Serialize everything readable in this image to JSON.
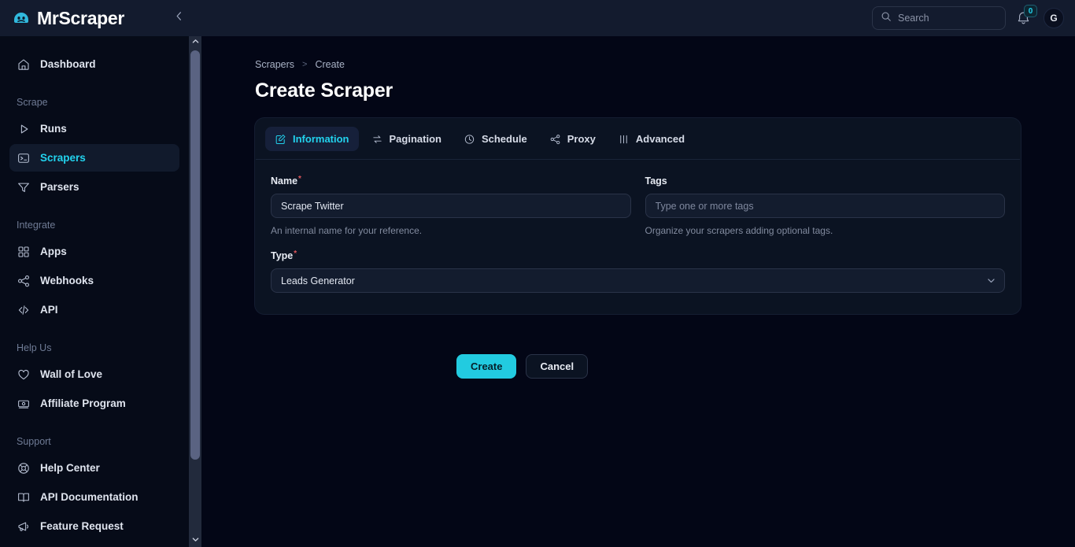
{
  "brand": {
    "name": "MrScraper",
    "logo_icon": "mrscraper-logo-icon",
    "accent": "#22d3ee"
  },
  "topbar": {
    "collapse_icon": "chevron-left-icon",
    "search": {
      "placeholder": "Search",
      "value": "",
      "icon": "search-icon"
    },
    "notifications": {
      "icon": "bell-icon",
      "count": "0"
    },
    "avatar": {
      "initial": "G"
    }
  },
  "sidebar": {
    "groups": [
      {
        "label": "",
        "items": [
          {
            "label": "Dashboard",
            "icon": "home-icon",
            "active": false
          }
        ]
      },
      {
        "label": "Scrape",
        "items": [
          {
            "label": "Runs",
            "icon": "play-icon",
            "active": false
          },
          {
            "label": "Scrapers",
            "icon": "terminal-icon",
            "active": true
          },
          {
            "label": "Parsers",
            "icon": "filter-icon",
            "active": false
          }
        ]
      },
      {
        "label": "Integrate",
        "items": [
          {
            "label": "Apps",
            "icon": "grid-icon",
            "active": false
          },
          {
            "label": "Webhooks",
            "icon": "share-icon",
            "active": false
          },
          {
            "label": "API",
            "icon": "code-icon",
            "active": false
          }
        ]
      },
      {
        "label": "Help Us",
        "items": [
          {
            "label": "Wall of Love",
            "icon": "heart-icon",
            "active": false
          },
          {
            "label": "Affiliate Program",
            "icon": "money-icon",
            "active": false
          }
        ]
      },
      {
        "label": "Support",
        "items": [
          {
            "label": "Help Center",
            "icon": "lifebuoy-icon",
            "active": false
          },
          {
            "label": "API Documentation",
            "icon": "book-icon",
            "active": false
          },
          {
            "label": "Feature Request",
            "icon": "megaphone-icon",
            "active": false
          }
        ]
      }
    ],
    "scrollbar": {
      "up_icon": "chevron-up-icon",
      "down_icon": "chevron-down-icon"
    }
  },
  "main": {
    "breadcrumb": {
      "parent": "Scrapers",
      "separator": ">",
      "current": "Create"
    },
    "title": "Create Scraper",
    "tabs": [
      {
        "label": "Information",
        "icon": "edit-square-icon",
        "active": true
      },
      {
        "label": "Pagination",
        "icon": "swap-arrows-icon",
        "active": false
      },
      {
        "label": "Schedule",
        "icon": "clock-icon",
        "active": false
      },
      {
        "label": "Proxy",
        "icon": "share-icon",
        "active": false
      },
      {
        "label": "Advanced",
        "icon": "sliders-icon",
        "active": false
      }
    ],
    "form": {
      "name": {
        "label": "Name",
        "required_marker": "*",
        "value": "Scrape Twitter",
        "placeholder": "",
        "hint": "An internal name for your reference."
      },
      "tags": {
        "label": "Tags",
        "value": "",
        "placeholder": "Type one or more tags",
        "hint": "Organize your scrapers adding optional tags."
      },
      "type": {
        "label": "Type",
        "required_marker": "*",
        "selected": "Leads Generator",
        "caret_icon": "chevron-down-icon"
      }
    },
    "actions": {
      "create_label": "Create",
      "cancel_label": "Cancel"
    }
  }
}
